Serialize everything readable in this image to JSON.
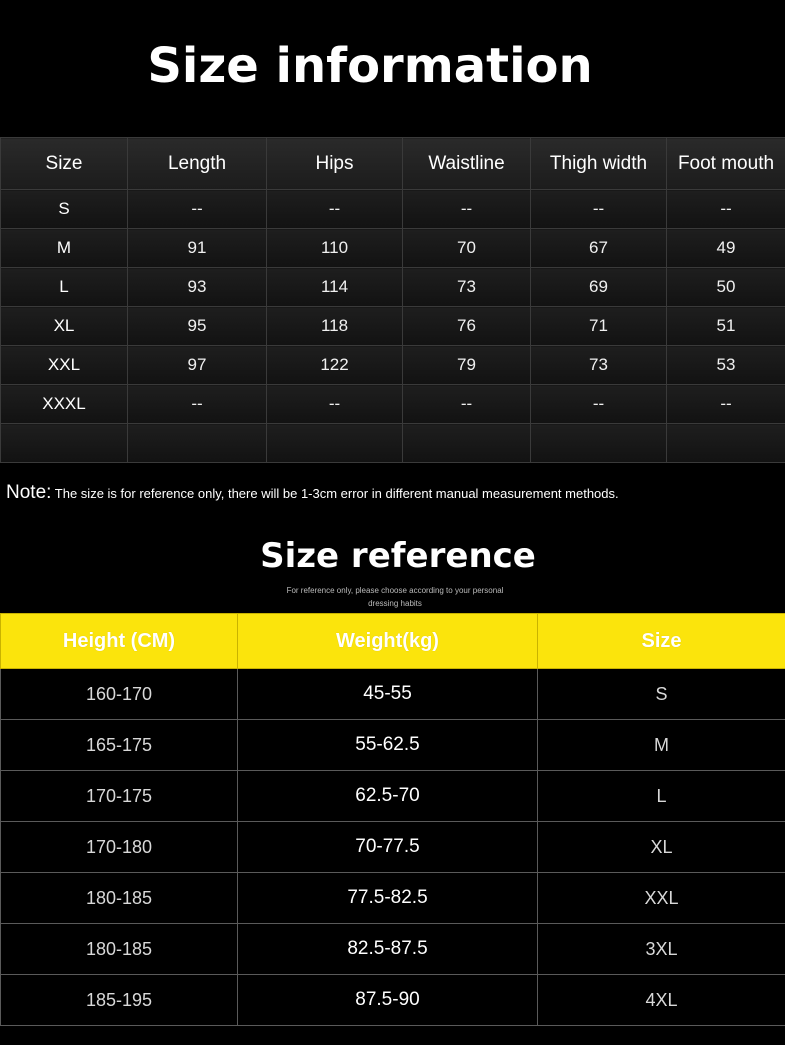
{
  "title": "Size information",
  "size_table": {
    "headers": [
      "Size",
      "Length",
      "Hips",
      "Waistline",
      "Thigh width",
      "Foot mouth"
    ],
    "rows": [
      [
        "S",
        "--",
        "--",
        "--",
        "--",
        "--"
      ],
      [
        "M",
        "91",
        "110",
        "70",
        "67",
        "49"
      ],
      [
        "L",
        "93",
        "114",
        "73",
        "69",
        "50"
      ],
      [
        "XL",
        "95",
        "118",
        "76",
        "71",
        "51"
      ],
      [
        "XXL",
        "97",
        "122",
        "79",
        "73",
        "53"
      ],
      [
        "XXXL",
        "--",
        "--",
        "--",
        "--",
        "--"
      ],
      [
        "",
        "",
        "",
        "",
        "",
        ""
      ]
    ]
  },
  "note": {
    "label": "Note:",
    "text": " The size is for reference only, there will be 1-3cm error in different manual measurement methods."
  },
  "reference": {
    "title": "Size reference",
    "subtitle_line1": "For reference only, please choose according to your personal",
    "subtitle_line2": "dressing habits",
    "headers": [
      "Height (CM)",
      "Weight(kg)",
      "Size"
    ],
    "rows": [
      [
        "160-170",
        "45-55",
        "S"
      ],
      [
        "165-175",
        "55-62.5",
        "M"
      ],
      [
        "170-175",
        "62.5-70",
        "L"
      ],
      [
        "170-180",
        "70-77.5",
        "XL"
      ],
      [
        "180-185",
        "77.5-82.5",
        "XXL"
      ],
      [
        "180-185",
        "82.5-87.5",
        "3XL"
      ],
      [
        "185-195",
        "87.5-90",
        "4XL"
      ]
    ]
  },
  "colors": {
    "header_yellow": "#fbe40c",
    "background": "#000000"
  }
}
